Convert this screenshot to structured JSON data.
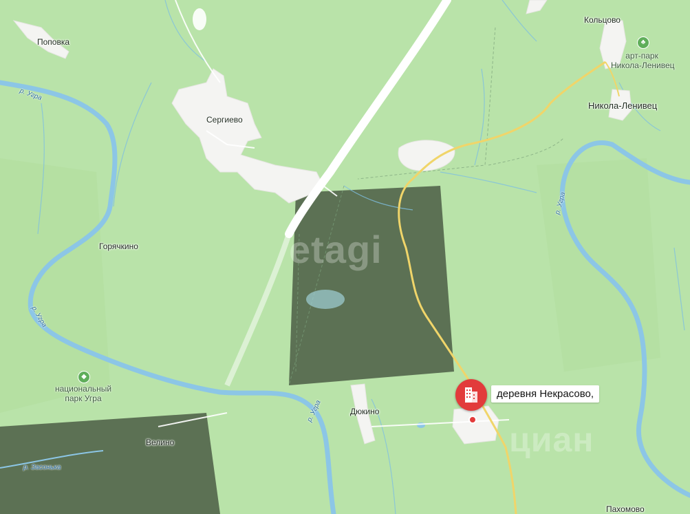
{
  "map": {
    "colors": {
      "forest": "#b8e2a8",
      "forest_dark": "#a9d998",
      "river": "#8cc6e6",
      "settlement": "#f4f4f2",
      "road_main": "#ffffff",
      "road_yellow": "#f0d56a",
      "marker": "#e23b3b"
    },
    "watermarks": [
      "etagi",
      "циан"
    ],
    "places": {
      "popovka": "Поповка",
      "sergievo": "Сергиево",
      "koltsovo": "Кольцово",
      "nikola_lenivets": "Никола-Ленивец",
      "goryachkino": "Горячкино",
      "dyukino": "Дюкино",
      "velino": "Велино",
      "pakhomovo": "Пахомово"
    },
    "rivers": {
      "ugra_1": "р. Угра",
      "ugra_2": "р. Угра",
      "ugra_3": "р. Угра",
      "ugra_4": "р. Угра",
      "zasonka": "р. Засонька"
    },
    "pois": {
      "art_park": {
        "line1": "арт-парк",
        "line2": "Никола-Ленивец",
        "icon": "tree-icon"
      },
      "national_park": {
        "line1": "национальный",
        "line2": "парк Угра",
        "icon": "animal-icon"
      }
    },
    "marker": {
      "icon": "building-icon",
      "label": "деревня Некрасово,"
    }
  }
}
